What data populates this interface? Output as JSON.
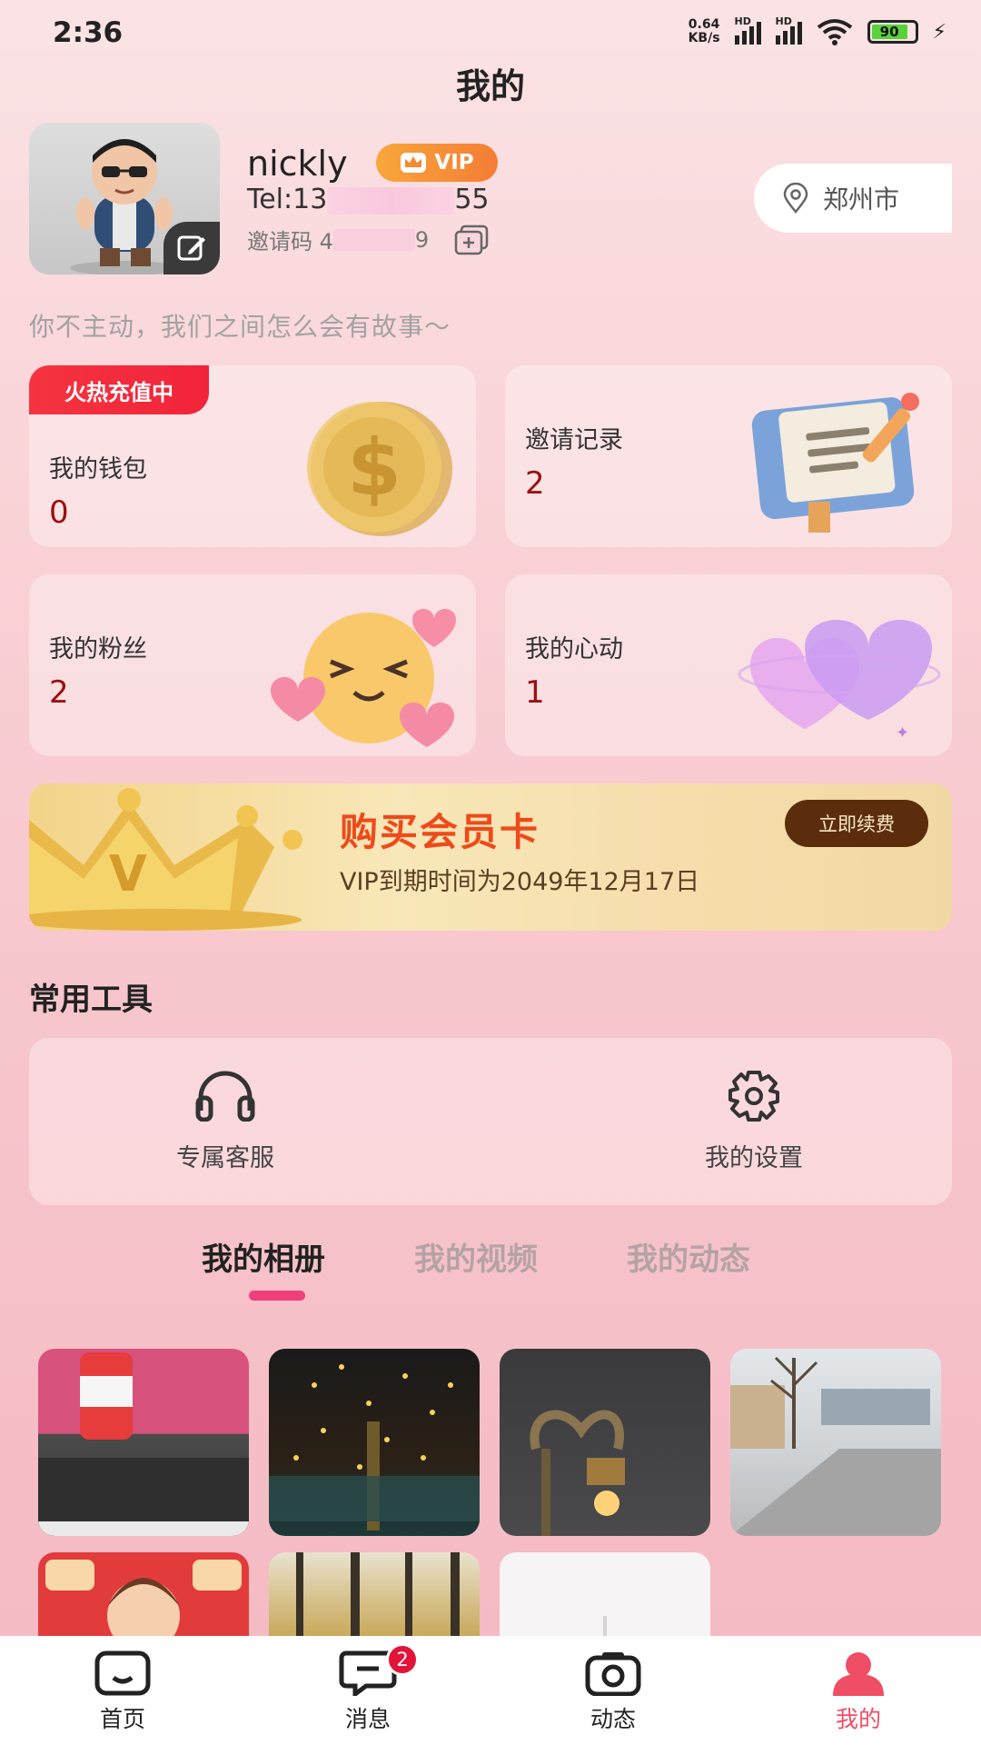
{
  "status_bar": {
    "time": "2:36",
    "net_speed_value": "0.64",
    "net_speed_unit": "KB/s",
    "signal_label": "HD",
    "battery": "90"
  },
  "header": {
    "title": "我的"
  },
  "profile": {
    "username": "nickly",
    "vip_label": "VIP",
    "tel_prefix": "Tel:13",
    "tel_suffix": "55",
    "invite_label": "邀请码 4",
    "invite_suffix": "9",
    "location": "郑州市",
    "slogan": "你不主动，我们之间怎么会有故事～"
  },
  "stats": {
    "wallet": {
      "tag": "火热充值中",
      "label": "我的钱包",
      "value": "0"
    },
    "invites": {
      "label": "邀请记录",
      "value": "2"
    },
    "fans": {
      "label": "我的粉丝",
      "value": "2"
    },
    "likes": {
      "label": "我的心动",
      "value": "1"
    }
  },
  "vip_banner": {
    "title": "购买会员卡",
    "expire_text": "VIP到期时间为2049年12月17日",
    "renew_label": "立即续费"
  },
  "tools": {
    "title": "常用工具",
    "service_label": "专属客服",
    "settings_label": "我的设置"
  },
  "tabs": [
    {
      "label": "我的相册",
      "active": true
    },
    {
      "label": "我的视频",
      "active": false
    },
    {
      "label": "我的动态",
      "active": false
    }
  ],
  "bottom_nav": [
    {
      "label": "首页",
      "icon": "home-icon"
    },
    {
      "label": "消息",
      "icon": "message-icon",
      "badge": "2"
    },
    {
      "label": "动态",
      "icon": "camera-icon"
    },
    {
      "label": "我的",
      "icon": "profile-icon",
      "active": true
    }
  ],
  "colors": {
    "accent": "#f04d66",
    "value_red": "#9b1010",
    "vip_orange": "#f47d35",
    "renew_brown": "#5b2d0c"
  }
}
